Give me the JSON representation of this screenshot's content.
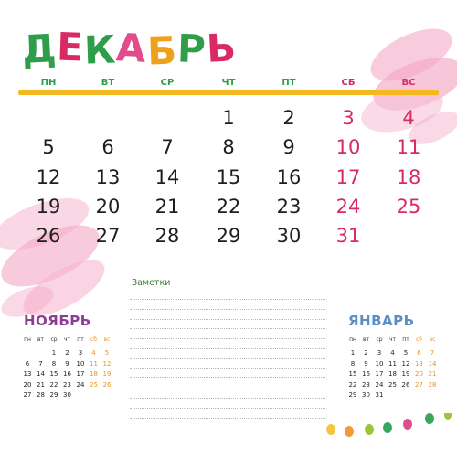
{
  "month": {
    "title_letters": [
      {
        "ch": "Д",
        "color": "#2e9e4a"
      },
      {
        "ch": "Е",
        "color": "#d92a63"
      },
      {
        "ch": "К",
        "color": "#2e9e4a"
      },
      {
        "ch": "А",
        "color": "#e24c8a"
      },
      {
        "ch": "Б",
        "color": "#f0a11c"
      },
      {
        "ch": "Р",
        "color": "#2e9e4a"
      },
      {
        "ch": "Ь",
        "color": "#d92a63"
      }
    ],
    "weekdays": [
      "ПН",
      "ВТ",
      "СР",
      "ЧТ",
      "ПТ",
      "СБ",
      "ВС"
    ],
    "weeks": [
      [
        "",
        "",
        "",
        "1",
        "2",
        "3",
        "4"
      ],
      [
        "5",
        "6",
        "7",
        "8",
        "9",
        "10",
        "11"
      ],
      [
        "12",
        "13",
        "14",
        "15",
        "16",
        "17",
        "18"
      ],
      [
        "19",
        "20",
        "21",
        "22",
        "23",
        "24",
        "25"
      ],
      [
        "26",
        "27",
        "28",
        "29",
        "30",
        "31",
        ""
      ]
    ]
  },
  "notes": {
    "title": "Заметки"
  },
  "prev_month": {
    "title": "НОЯБРЬ",
    "weekdays": [
      "пн",
      "вт",
      "ср",
      "чт",
      "пт",
      "сб",
      "вс"
    ],
    "weeks": [
      [
        "",
        "",
        "1",
        "2",
        "3",
        "4",
        "5"
      ],
      [
        "6",
        "7",
        "8",
        "9",
        "10",
        "11",
        "12"
      ],
      [
        "13",
        "14",
        "15",
        "16",
        "17",
        "18",
        "19"
      ],
      [
        "20",
        "21",
        "22",
        "23",
        "24",
        "25",
        "26"
      ],
      [
        "27",
        "28",
        "29",
        "30",
        "",
        "",
        ""
      ]
    ]
  },
  "next_month": {
    "title": "ЯНВАРЬ",
    "weekdays": [
      "пн",
      "вт",
      "ср",
      "чт",
      "пт",
      "сб",
      "вс"
    ],
    "weeks": [
      [
        "1",
        "2",
        "3",
        "4",
        "5",
        "6",
        "7"
      ],
      [
        "8",
        "9",
        "10",
        "11",
        "12",
        "13",
        "14"
      ],
      [
        "15",
        "16",
        "17",
        "18",
        "19",
        "20",
        "21"
      ],
      [
        "22",
        "23",
        "24",
        "25",
        "26",
        "27",
        "28"
      ],
      [
        "29",
        "30",
        "31",
        "",
        "",
        "",
        ""
      ]
    ]
  },
  "colors": {
    "weekday_text": "#2e9e4a",
    "weekend_text": "#d92a63",
    "day_text": "#1e1e1e",
    "rule": "#f5b81e",
    "prev_title": "#8a3f93",
    "next_title": "#5b8fc4",
    "mini_weekend": "#e5962a"
  }
}
